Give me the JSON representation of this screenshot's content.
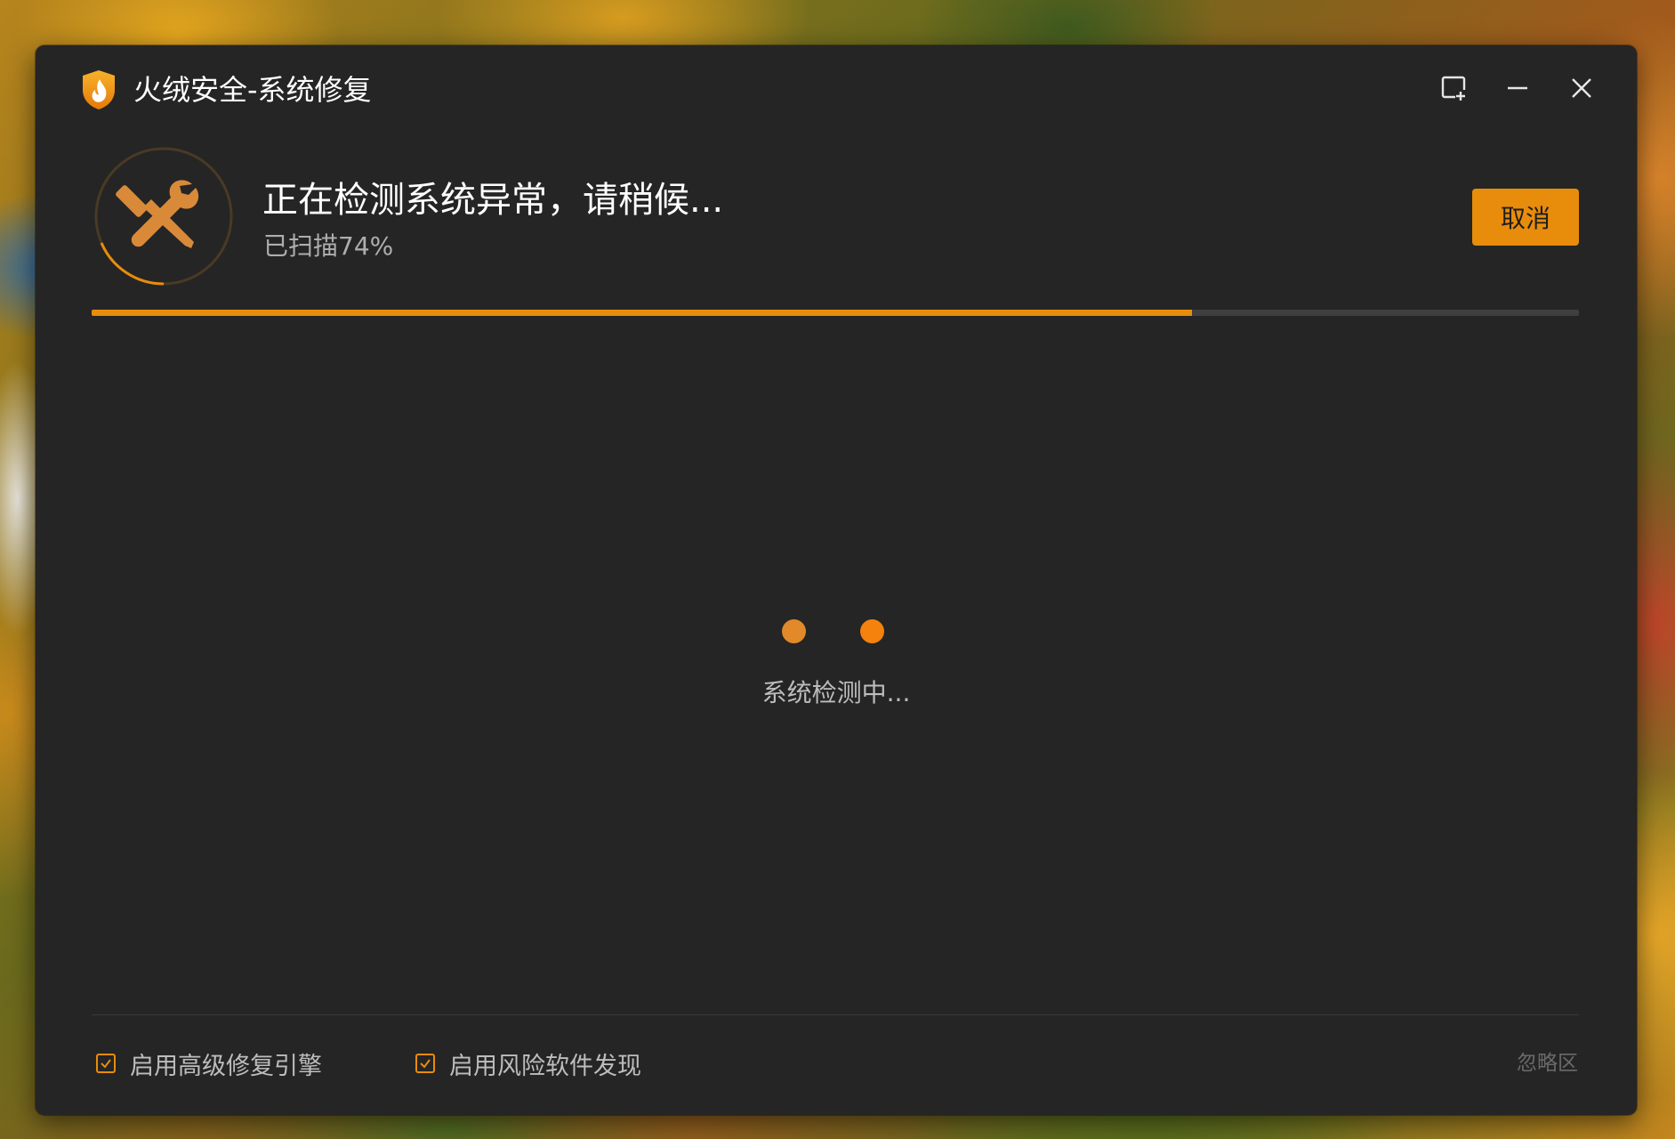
{
  "window": {
    "title": "火绒安全-系统修复"
  },
  "titlebar": {
    "icons": [
      "shield-flame-logo-icon",
      "feedback-icon",
      "minimize-icon",
      "close-icon"
    ]
  },
  "header": {
    "status_title": "正在检测系统异常，请稍候...",
    "status_sub": "已扫描74%",
    "progress_percent": 74,
    "cancel_label": "取消",
    "status_icon": "wrench-screwdriver-icon"
  },
  "main": {
    "loading_text": "系统检测中..."
  },
  "footer": {
    "options": [
      {
        "label": "启用高级修复引擎",
        "checked": true
      },
      {
        "label": "启用风险软件发现",
        "checked": true
      }
    ],
    "ignore_label": "忽略区"
  },
  "colors": {
    "accent": "#e88c0b",
    "window_bg": "#252525",
    "progress_track": "#3f3f3f"
  }
}
